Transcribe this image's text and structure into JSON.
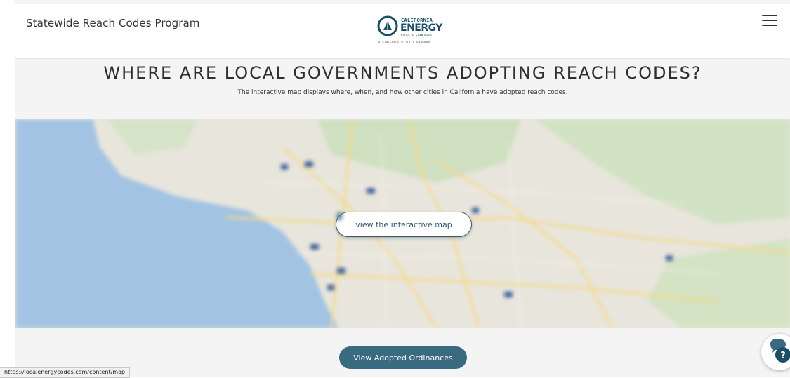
{
  "header": {
    "site_title": "Statewide Reach Codes Program",
    "logo": {
      "line1": "CALIFORNIA",
      "line2": "ENERGY",
      "line3": "CODES & STANDARDS",
      "line4": "A STATEWIDE UTILITY PROGRAM"
    },
    "menu_icon": "hamburger-icon"
  },
  "section": {
    "heading": "WHERE ARE LOCAL GOVERNMENTS ADOPTING REACH CODES?",
    "subtext": "The interactive map displays where, when, and how other cities in California have adopted reach codes."
  },
  "map": {
    "button_label": "view the interactive map",
    "button_icon": "map-pin-icon"
  },
  "ordinances_button_label": "View Adopted Ordinances",
  "status_bar_url": "https://localenergycodes.com/content/map",
  "help_chat_icon": "chat-help-icon",
  "colors": {
    "brand": "#1c4f66",
    "button": "#3a6a80",
    "water": "#a3c3e3"
  }
}
